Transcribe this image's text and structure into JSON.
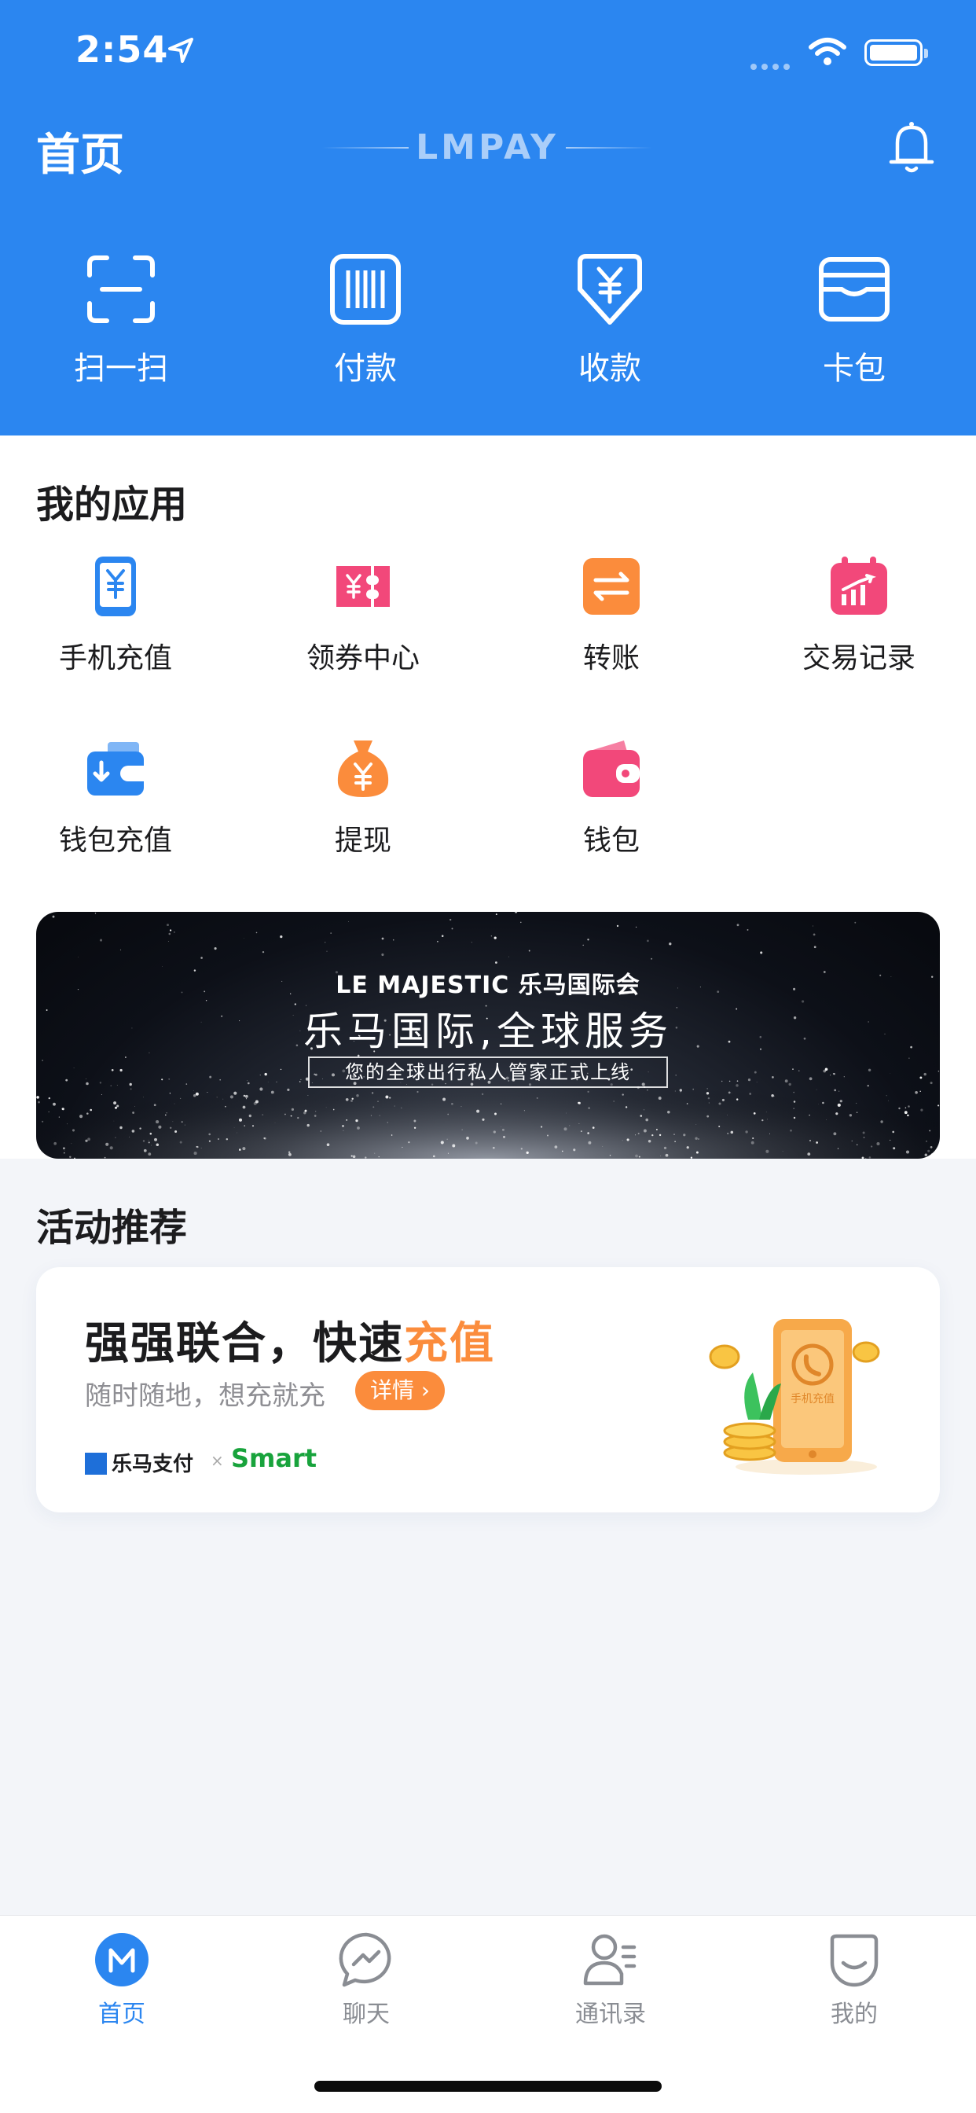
{
  "status_bar": {
    "time": "2:54"
  },
  "header": {
    "title": "首页",
    "brand": "LMPAY",
    "quick_actions": [
      {
        "label": "扫一扫",
        "icon": "scan-icon"
      },
      {
        "label": "付款",
        "icon": "barcode-icon"
      },
      {
        "label": "收款",
        "icon": "receive-yuan-icon"
      },
      {
        "label": "卡包",
        "icon": "card-wallet-icon"
      }
    ]
  },
  "my_apps": {
    "title": "我的应用",
    "items": [
      {
        "label": "手机充值",
        "icon": "phone-recharge-icon",
        "color": "#2b86f0"
      },
      {
        "label": "领券中心",
        "icon": "coupon-icon",
        "color": "#f2487a"
      },
      {
        "label": "转账",
        "icon": "transfer-icon",
        "color": "#fb8c3c"
      },
      {
        "label": "交易记录",
        "icon": "transaction-record-icon",
        "color": "#f2487a"
      },
      {
        "label": "钱包充值",
        "icon": "wallet-recharge-icon",
        "color": "#2b86f0"
      },
      {
        "label": "提现",
        "icon": "withdraw-icon",
        "color": "#fb8c3c"
      },
      {
        "label": "钱包",
        "icon": "wallet-icon",
        "color": "#f2487a"
      }
    ]
  },
  "banner": {
    "brand": "LE MAJESTIC 乐马国际会",
    "title": "乐马国际,全球服务",
    "subtitle": "您的全球出行私人管家正式上线"
  },
  "activity": {
    "title": "活动推荐",
    "headline_main": "强强联合，快速",
    "headline_accent": "充值",
    "subtext": "随时随地，想充就充",
    "button": "详情 ›",
    "partner1": "乐马支付",
    "separator": "×",
    "partner2": "Smart",
    "art_label": "手机充值"
  },
  "tabbar": {
    "items": [
      {
        "label": "首页",
        "icon": "home-m-icon",
        "active": true
      },
      {
        "label": "聊天",
        "icon": "chat-icon",
        "active": false
      },
      {
        "label": "通讯录",
        "icon": "contacts-icon",
        "active": false
      },
      {
        "label": "我的",
        "icon": "profile-smile-icon",
        "active": false
      }
    ]
  },
  "colors": {
    "primary": "#2b86f0",
    "accent_orange": "#fb8c3c",
    "accent_pink": "#f2487a",
    "background": "#f3f5f9"
  }
}
